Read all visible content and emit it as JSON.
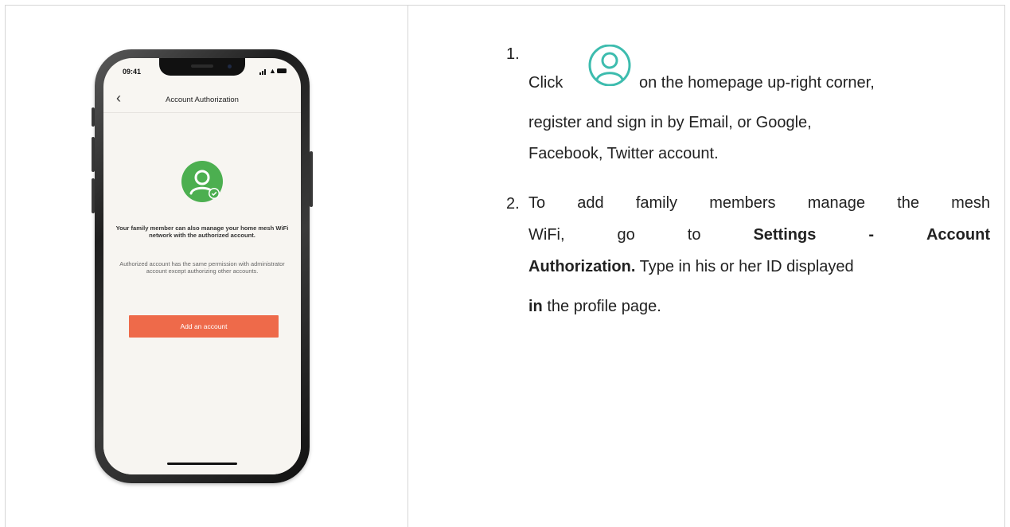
{
  "phone": {
    "status_time": "09:41",
    "nav_title": "Account Authorization",
    "description": "Your family member can also manage your home mesh WiFi network with the authorized account.",
    "note": "Authorized account has the same permission with administrator account except authorizing other accounts.",
    "add_button": "Add an account",
    "colors": {
      "avatar": "#4caf50",
      "button": "#ee6a4a"
    }
  },
  "steps": {
    "step1": {
      "number": "1.",
      "click": "Click",
      "line1_rest": "on the homepage up-right corner,",
      "line2": "register and sign in by Email, or Google,",
      "line3": "Facebook, Twitter account.",
      "icon": "user-icon",
      "icon_color": "#3dbcae"
    },
    "step2": {
      "number": "2.",
      "line1": [
        "To",
        "add",
        "family",
        "members",
        "manage",
        "the",
        "mesh"
      ],
      "line2_words": [
        "WiFi,",
        "go",
        "to"
      ],
      "line2_bold": [
        "Settings",
        "-",
        "Account"
      ],
      "line3_bold": "Authorization.",
      "line3_rest": "Type in his or her ID displayed",
      "line4_bold": "in",
      "line4_rest": "the profile page."
    }
  }
}
